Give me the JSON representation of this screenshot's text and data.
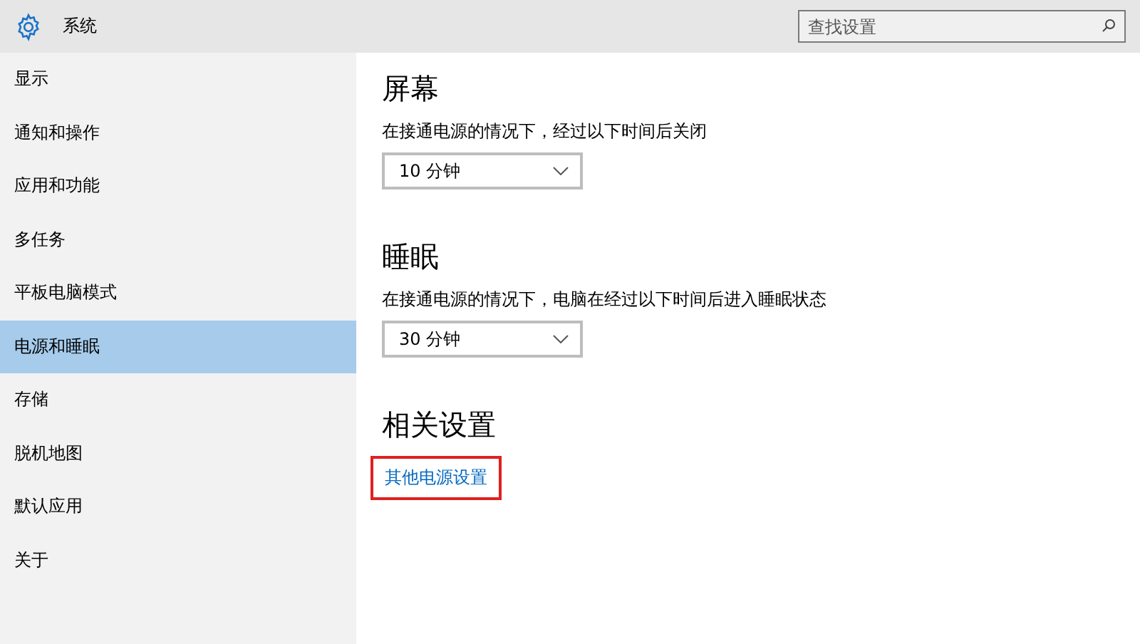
{
  "header": {
    "title": "系统",
    "search": {
      "placeholder": "查找设置"
    }
  },
  "sidebar": {
    "items": [
      {
        "label": "显示",
        "selected": false
      },
      {
        "label": "通知和操作",
        "selected": false
      },
      {
        "label": "应用和功能",
        "selected": false
      },
      {
        "label": "多任务",
        "selected": false
      },
      {
        "label": "平板电脑模式",
        "selected": false
      },
      {
        "label": "电源和睡眠",
        "selected": true
      },
      {
        "label": "存储",
        "selected": false
      },
      {
        "label": "脱机地图",
        "selected": false
      },
      {
        "label": "默认应用",
        "selected": false
      },
      {
        "label": "关于",
        "selected": false
      }
    ]
  },
  "sections": [
    {
      "kind": "dropdown",
      "heading": "屏幕",
      "description": "在接通电源的情况下，经过以下时间后关闭",
      "value": "10 分钟"
    },
    {
      "kind": "dropdown",
      "heading": "睡眠",
      "description": "在接通电源的情况下，电脑在经过以下时间后进入睡眠状态",
      "value": "30 分钟"
    },
    {
      "kind": "links",
      "heading": "相关设置",
      "links": [
        {
          "label": "其他电源设置",
          "highlighted": true
        }
      ]
    }
  ]
}
